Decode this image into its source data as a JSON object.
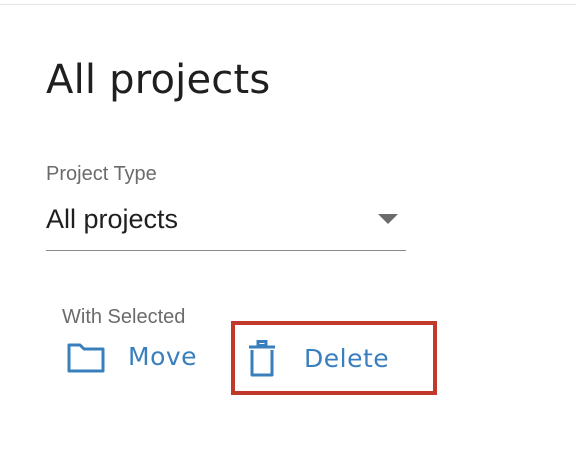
{
  "page": {
    "title": "All projects"
  },
  "filter": {
    "label": "Project Type",
    "selected_value": "All projects"
  },
  "bulk_actions": {
    "label": "With Selected",
    "move_label": "Move",
    "move_icon": "folder-icon",
    "delete_label": "Delete",
    "delete_icon": "trash-icon"
  },
  "colors": {
    "accent": "#3a7fbd",
    "highlight": "#c0392b",
    "text": "#1f1f1f",
    "muted": "#6b6b6b"
  }
}
